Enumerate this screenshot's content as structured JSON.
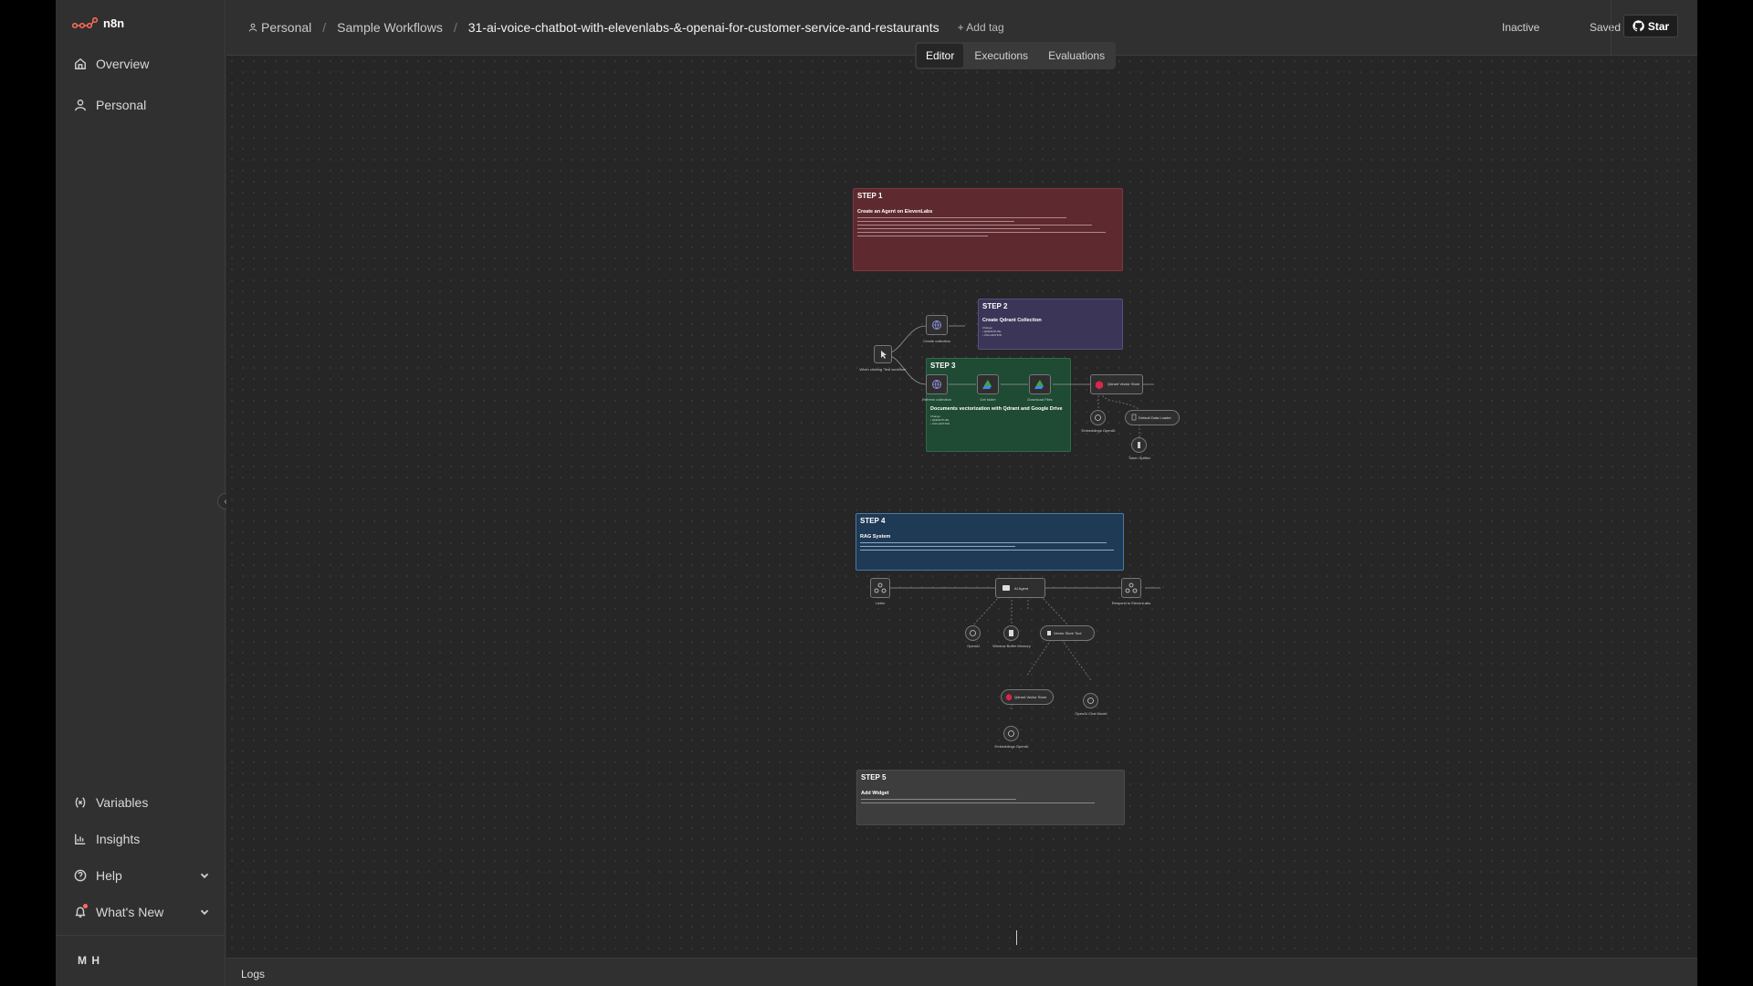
{
  "app": {
    "name": "n8n",
    "brand_color": "#ff6d5a"
  },
  "sidebar": {
    "top_items": [
      {
        "label": "Overview",
        "icon": "home-icon"
      },
      {
        "label": "Personal",
        "icon": "user-icon"
      }
    ],
    "bottom_items": [
      {
        "label": "Variables",
        "icon": "variables-icon"
      },
      {
        "label": "Insights",
        "icon": "insights-icon"
      },
      {
        "label": "Help",
        "icon": "help-icon"
      },
      {
        "label": "What's New",
        "icon": "bell-icon"
      }
    ],
    "user_initials": "M H"
  },
  "header": {
    "breadcrumb": {
      "project": "Personal",
      "folder": "Sample Workflows",
      "workflow": "31-ai-voice-chatbot-with-elevenlabs-&-openai-for-customer-service-and-restaurants"
    },
    "add_tag": "+ Add tag",
    "active_status": "Inactive",
    "save_status": "Saved",
    "star_label": "Star",
    "tabs": [
      "Editor",
      "Executions",
      "Evaluations"
    ]
  },
  "canvas": {
    "step1": {
      "title": "STEP 1",
      "subtitle": "Create an Agent on ElevenLabs",
      "color": "#5e2a2f"
    },
    "step2": {
      "title": "STEP 2",
      "subtitle": "Create Qdrant Collection",
      "body": "Change:\n• QDRANTURL\n• COLLECTION",
      "color": "#3b3658"
    },
    "step3": {
      "title": "STEP 3",
      "subtitle": "Documents vectorization with Qdrant and Google Drive",
      "body": "Change:\n• QDRANTURL\n• COLLECTION",
      "color": "#1f4a33"
    },
    "step4": {
      "title": "STEP 4",
      "subtitle": "RAG System",
      "color": "#1f3a55"
    },
    "step5": {
      "title": "STEP 5",
      "subtitle": "Add Widget",
      "color": "#3d3d3d"
    },
    "nodes": {
      "trigger": "When clicking 'Test workflow'",
      "create_collection": "Create collection",
      "refresh_collection": "Refresh collection",
      "get_folder": "Get folder",
      "download_files": "Download Files",
      "qdrant_vector_store": "Qdrant Vector Store",
      "embeddings_openai": "Embeddings OpenAI",
      "default_data_loader": "Default Data Loader",
      "token_splitter": "Token Splitter",
      "listen": "Listen",
      "ai_agent": "AI Agent",
      "respond": "Respond to ElevenLabs",
      "openai": "OpenAI",
      "window_memory": "Window Buffer Memory",
      "vector_store_tool": "Vector Store Tool",
      "qdrant_vector_store2": "Qdrant Vector Store",
      "openai_chat_model": "OpenAI Chat Model",
      "embeddings_openai2": "Embeddings OpenAI"
    }
  },
  "logs": {
    "label": "Logs"
  }
}
